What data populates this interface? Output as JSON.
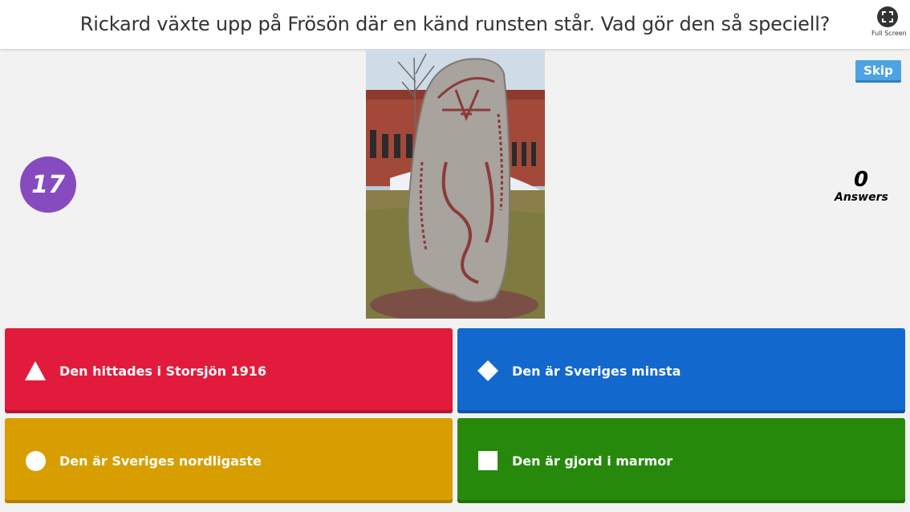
{
  "question": "Rickard växte upp på Frösön där en känd runsten står. Vad gör den så speciell?",
  "fullscreen_label": "Full Screen",
  "skip_label": "Skip",
  "timer": "17",
  "answers_count": "0",
  "answers_label": "Answers",
  "image_alt": "runestone",
  "options": [
    {
      "label": "Den hittades i Storsjön 1916",
      "shape": "triangle-icon",
      "color": "#e21b3c"
    },
    {
      "label": "Den är Sveriges minsta",
      "shape": "diamond-icon",
      "color": "#1368ce"
    },
    {
      "label": "Den är Sveriges nordligaste",
      "shape": "circle-icon",
      "color": "#d89e00"
    },
    {
      "label": "Den är gjord i marmor",
      "shape": "square-icon",
      "color": "#26890c"
    }
  ]
}
